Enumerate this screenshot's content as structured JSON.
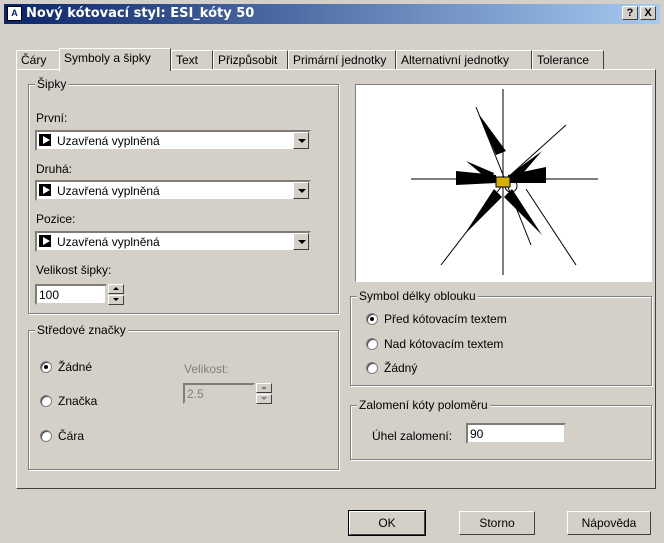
{
  "window": {
    "title": "Nový kótovací styl: ESI_kóty 50",
    "help_btn": "?",
    "close_btn": "X"
  },
  "tabs": [
    {
      "label": "Čáry"
    },
    {
      "label": "Symboly a šipky"
    },
    {
      "label": "Text"
    },
    {
      "label": "Přizpůsobit"
    },
    {
      "label": "Primární jednotky"
    },
    {
      "label": "Alternativní jednotky"
    },
    {
      "label": "Tolerance"
    }
  ],
  "arrows": {
    "group_label": "Šipky",
    "first_label": "První:",
    "first_value": "Uzavřená vyplněná",
    "second_label": "Druhá:",
    "second_value": "Uzavřená vyplněná",
    "leader_label": "Pozice:",
    "leader_value": "Uzavřená vyplněná",
    "size_label": "Velikost šipky:",
    "size_value": "100"
  },
  "center_marks": {
    "group_label": "Středové značky",
    "none_label": "Žádné",
    "mark_label": "Značka",
    "line_label": "Čára",
    "size_label": "Velikost:",
    "size_value": "2.5",
    "selected": "none"
  },
  "arc_length": {
    "group_label": "Symbol délky oblouku",
    "before_label": "Před kótovacím textem",
    "above_label": "Nad kótovacím textem",
    "none_label": "Žádný",
    "selected": "before"
  },
  "radius_jog": {
    "group_label": "Zalomení kóty poloměru",
    "angle_label": "Úhel zalomení:",
    "angle_value": "90"
  },
  "buttons": {
    "ok": "OK",
    "cancel": "Storno",
    "help": "Nápověda"
  },
  "colors": {
    "titlebar_start": "#0a246a",
    "titlebar_end": "#a6caf0",
    "face": "#d4d0c8"
  }
}
